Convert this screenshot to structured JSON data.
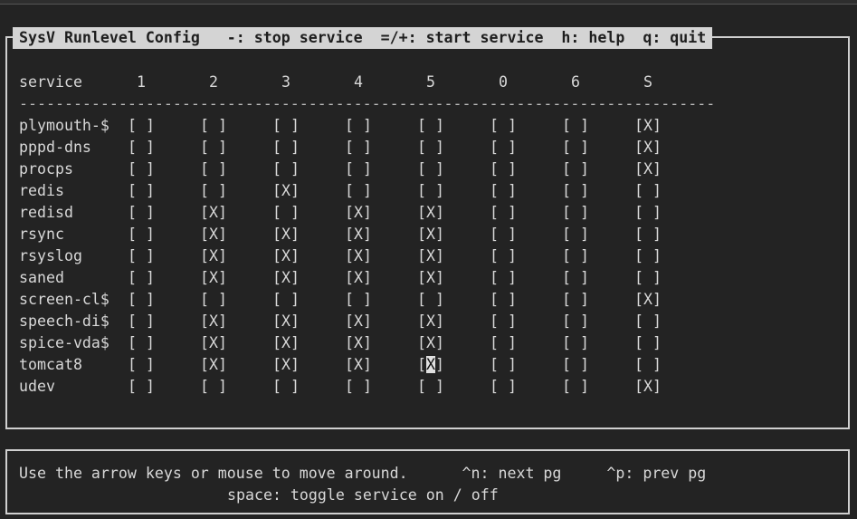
{
  "title": "SysV Runlevel Config   -: stop service  =/+: start service  h: help  q: quit",
  "header": {
    "service_label": "service",
    "runlevels": [
      "1",
      "2",
      "3",
      "4",
      "5",
      "0",
      "6",
      "S"
    ]
  },
  "separator": "-----------------------------------------------------------------------------",
  "services": [
    {
      "name": "plymouth-$",
      "levels": [
        false,
        false,
        false,
        false,
        false,
        false,
        false,
        true
      ]
    },
    {
      "name": "pppd-dns",
      "levels": [
        false,
        false,
        false,
        false,
        false,
        false,
        false,
        true
      ]
    },
    {
      "name": "procps",
      "levels": [
        false,
        false,
        false,
        false,
        false,
        false,
        false,
        true
      ]
    },
    {
      "name": "redis",
      "levels": [
        false,
        false,
        true,
        false,
        false,
        false,
        false,
        false
      ]
    },
    {
      "name": "redisd",
      "levels": [
        false,
        true,
        false,
        true,
        true,
        false,
        false,
        false
      ]
    },
    {
      "name": "rsync",
      "levels": [
        false,
        true,
        true,
        true,
        true,
        false,
        false,
        false
      ]
    },
    {
      "name": "rsyslog",
      "levels": [
        false,
        true,
        true,
        true,
        true,
        false,
        false,
        false
      ]
    },
    {
      "name": "saned",
      "levels": [
        false,
        true,
        true,
        true,
        true,
        false,
        false,
        false
      ]
    },
    {
      "name": "screen-cl$",
      "levels": [
        false,
        false,
        false,
        false,
        false,
        false,
        false,
        true
      ]
    },
    {
      "name": "speech-di$",
      "levels": [
        false,
        true,
        true,
        true,
        true,
        false,
        false,
        false
      ]
    },
    {
      "name": "spice-vda$",
      "levels": [
        false,
        true,
        true,
        true,
        true,
        false,
        false,
        false
      ]
    },
    {
      "name": "tomcat8",
      "levels": [
        false,
        true,
        true,
        true,
        true,
        false,
        false,
        false
      ]
    },
    {
      "name": "udev",
      "levels": [
        false,
        false,
        false,
        false,
        false,
        false,
        false,
        true
      ]
    }
  ],
  "cursor": {
    "service": "tomcat8",
    "runlevel": "5"
  },
  "footer": {
    "line1": "Use the arrow keys or mouse to move around.      ^n: next pg     ^p: prev pg",
    "line2": "space: toggle service on / off"
  }
}
